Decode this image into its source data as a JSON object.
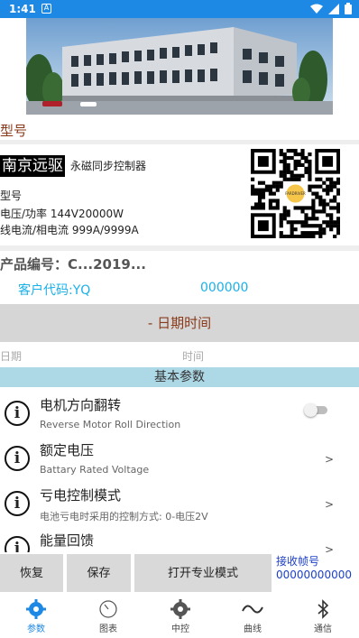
{
  "status_bar": {
    "time": "1:41",
    "notification_icon": "A"
  },
  "section_model": "型号",
  "device": {
    "brand": "南京远驱",
    "subtitle": "永磁同步控制器",
    "model_label": "型号",
    "voltage_power": "电压/功率  144V20000W",
    "current": "线电流/相电流  999A/9999A",
    "qr_logo_text": "FARDRIVER"
  },
  "product_number": "产品编号：C...2019...",
  "customer": {
    "label": "客户代码:YQ",
    "value": "000000"
  },
  "date_section": {
    "title": "- 日期时间",
    "date_label": "日期",
    "time_label": "时间"
  },
  "basic_params_title": "基本参数",
  "params": [
    {
      "title": "电机方向翻转",
      "desc": "Reverse Motor Roll Direction",
      "control": "toggle",
      "toggle_on": false
    },
    {
      "title": "额定电压",
      "desc": "Battary Rated Voltage",
      "control": ">"
    },
    {
      "title": "亏电控制模式",
      "desc": "电池亏电时采用的控制方式:  0-电压2V",
      "control": ">"
    },
    {
      "title": "能量回馈",
      "desc": "",
      "control": ">"
    }
  ],
  "buttons": {
    "restore": "恢复",
    "save": "保存",
    "open_pro": "打开专业模式"
  },
  "receive": {
    "label": "接收帧号",
    "value": "00000000000"
  },
  "tabs": [
    {
      "label": "参数",
      "icon": "gear-icon",
      "active": true
    },
    {
      "label": "图表",
      "icon": "gauge-icon",
      "active": false
    },
    {
      "label": "中控",
      "icon": "gear-icon",
      "active": false
    },
    {
      "label": "曲线",
      "icon": "wave-icon",
      "active": false
    },
    {
      "label": "通信",
      "icon": "bluetooth-icon",
      "active": false
    }
  ],
  "colors": {
    "status_bar": "#1e88e5",
    "accent": "#1e88e5",
    "section_title": "#8a3a1a",
    "customer_text": "#1ab0e8",
    "basic_bar": "#add8e6",
    "receive_text": "#1e40c8"
  }
}
